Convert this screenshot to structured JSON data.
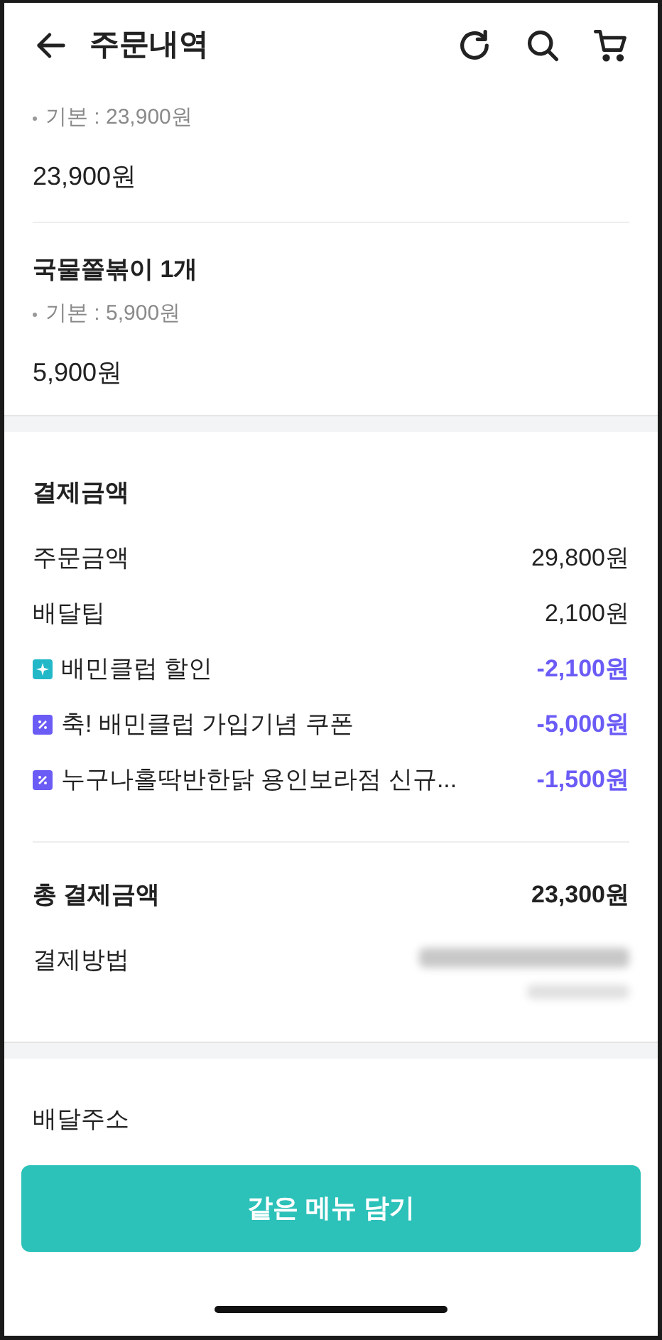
{
  "header": {
    "title": "주문내역"
  },
  "items": [
    {
      "option": "기본 : 23,900원",
      "price": "23,900원"
    },
    {
      "name": "국물쫄볶이 1개",
      "option": "기본 : 5,900원",
      "price": "5,900원"
    }
  ],
  "payment": {
    "title": "결제금액",
    "rows": [
      {
        "kind": "plain",
        "label": "주문금액",
        "amount": "29,800원"
      },
      {
        "kind": "plain",
        "label": "배달팁",
        "amount": "2,100원"
      },
      {
        "kind": "club",
        "label": "배민클럽 할인",
        "amount": "-2,100원"
      },
      {
        "kind": "coupon",
        "label": "축! 배민클럽 가입기념 쿠폰",
        "amount": "-5,000원"
      },
      {
        "kind": "coupon",
        "label": "누구나홀딱반한닭 용인보라점 신규...",
        "amount": "-1,500원"
      }
    ],
    "total_label": "총 결제금액",
    "total": "23,300원",
    "method_label": "결제방법"
  },
  "delivery": {
    "title": "배달주소"
  },
  "button": "같은 메뉴 담기"
}
